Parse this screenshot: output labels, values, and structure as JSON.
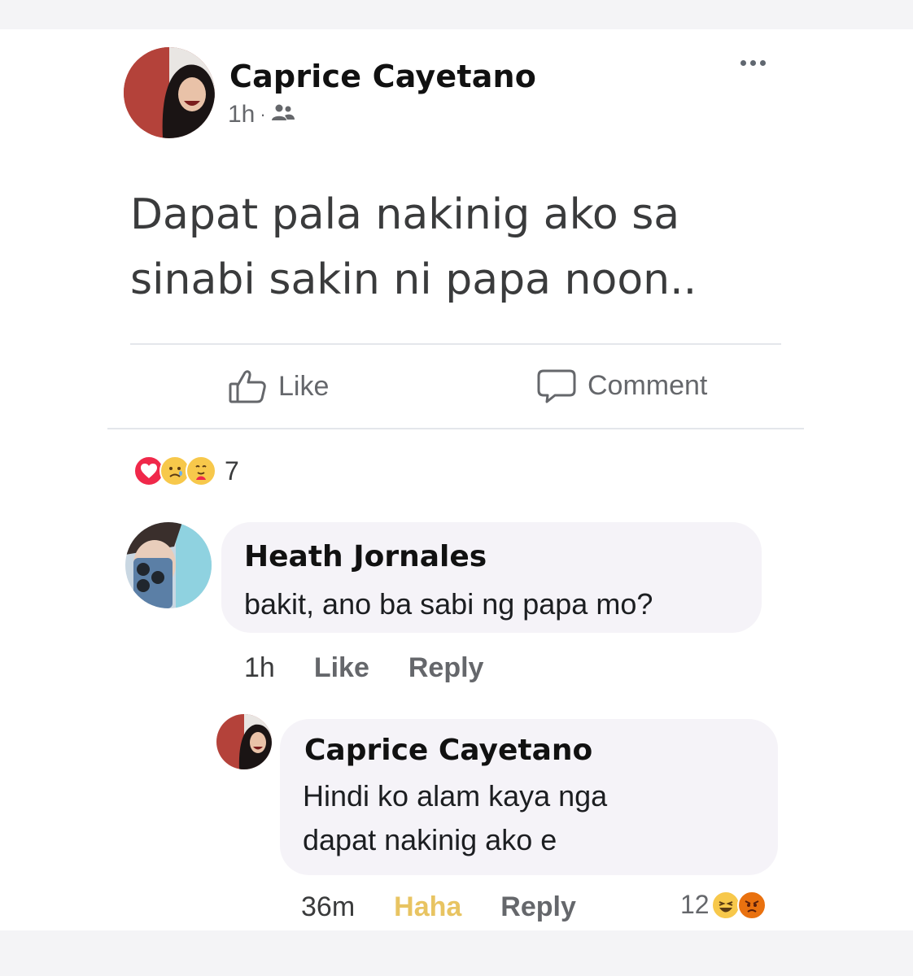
{
  "post": {
    "author": "Caprice Cayetano",
    "time": "1h",
    "separator": "·",
    "audience_icon": "friends-icon",
    "more_icon": "more-options-icon",
    "text_line1": "Dapat pala nakinig ako sa",
    "text_line2": "sinabi sakin ni papa noon.."
  },
  "actions": {
    "like_label": "Like",
    "comment_label": "Comment"
  },
  "reactions": {
    "icons": [
      "love-icon",
      "care-sad-icon",
      "care-hug-icon"
    ],
    "count": "7"
  },
  "comments": [
    {
      "author": "Heath Jornales",
      "text": "bakit, ano ba sabi ng papa mo?",
      "time": "1h",
      "like_label": "Like",
      "reply_label": "Reply"
    },
    {
      "author": "Caprice Cayetano",
      "text_line1": "Hindi ko alam kaya nga",
      "text_line2": "dapat nakinig ako e",
      "time": "36m",
      "reaction_label": "Haha",
      "reply_label": "Reply",
      "reaction_count": "12",
      "reaction_icons": [
        "haha-icon",
        "angry-icon"
      ]
    }
  ],
  "colors": {
    "haha": "#e8c462",
    "love": "#f0284a",
    "angry": "#e9710f",
    "muted": "#65676b"
  }
}
